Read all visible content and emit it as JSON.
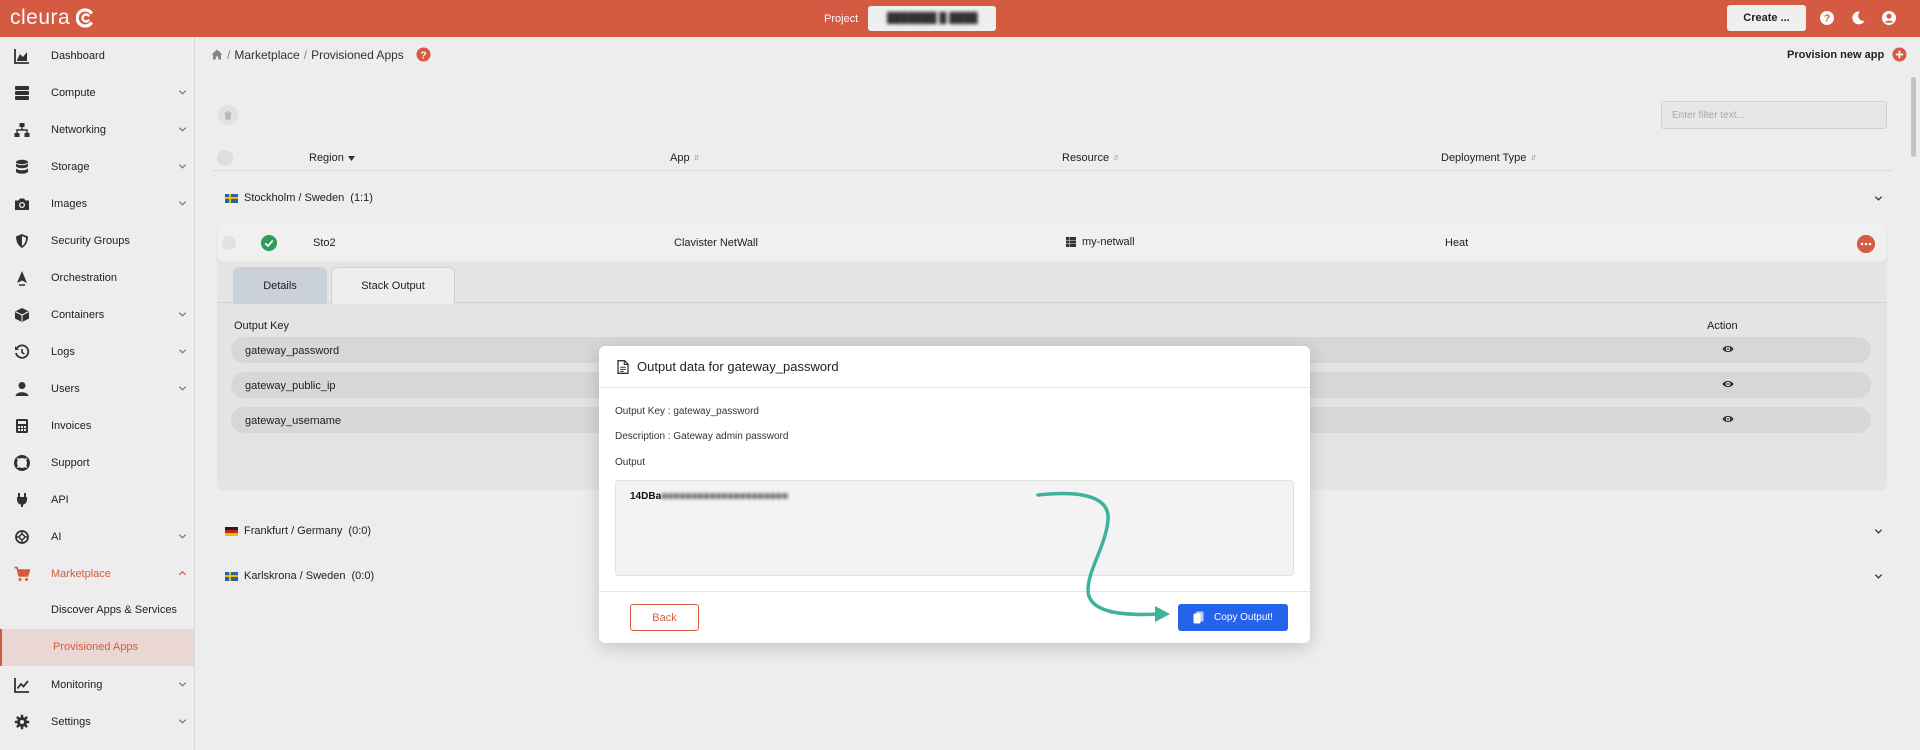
{
  "header": {
    "logo_text": "cleura",
    "project_label": "Project",
    "project_value": "███████ █ ████",
    "create_label": "Create ...",
    "colors": {
      "bar": "#d95c43"
    }
  },
  "sidebar": {
    "items": [
      {
        "label": "Dashboard",
        "icon": "chart-area-icon"
      },
      {
        "label": "Compute",
        "icon": "server-icon"
      },
      {
        "label": "Networking",
        "icon": "network-icon"
      },
      {
        "label": "Storage",
        "icon": "database-icon"
      },
      {
        "label": "Images",
        "icon": "camera-icon"
      },
      {
        "label": "Security Groups",
        "icon": "shield-icon"
      },
      {
        "label": "Orchestration",
        "icon": "orchestration-icon"
      },
      {
        "label": "Containers",
        "icon": "cube-icon"
      },
      {
        "label": "Logs",
        "icon": "history-icon"
      },
      {
        "label": "Users",
        "icon": "user-icon"
      },
      {
        "label": "Invoices",
        "icon": "calculator-icon"
      },
      {
        "label": "Support",
        "icon": "lifebuoy-icon"
      },
      {
        "label": "API",
        "icon": "plug-icon"
      },
      {
        "label": "AI",
        "icon": "ai-icon"
      },
      {
        "label": "Marketplace",
        "icon": "cart-icon"
      },
      {
        "label": "Monitoring",
        "icon": "line-chart-icon"
      },
      {
        "label": "Settings",
        "icon": "gear-icon"
      }
    ],
    "marketplace_sub": [
      {
        "label": "Discover Apps & Services"
      },
      {
        "label": "Provisioned Apps"
      }
    ]
  },
  "main": {
    "breadcrumb": [
      "Marketplace",
      "Provisioned Apps"
    ],
    "provision_label": "Provision new app",
    "filter_placeholder": "Enter filter text...",
    "columns": [
      "Region",
      "App",
      "Resource",
      "Deployment Type"
    ],
    "groups": [
      {
        "label": "Stockholm / Sweden",
        "count": "(1:1)"
      },
      {
        "label": "Frankfurt / Germany",
        "count": "(0:0)"
      },
      {
        "label": "Karlskrona / Sweden",
        "count": "(0:0)"
      }
    ],
    "row": {
      "region": "Sto2",
      "app": "Clavister NetWall",
      "resource": "my-netwall",
      "deployment": "Heat"
    },
    "tabs": [
      "Details",
      "Stack Output"
    ],
    "output_headers": {
      "key": "Output Key",
      "action": "Action"
    },
    "output_keys": [
      "gateway_password",
      "gateway_public_ip",
      "gateway_username"
    ]
  },
  "modal": {
    "title": "Output data for gateway_password",
    "output_key_line": "Output Key : gateway_password",
    "description_line": "Description : Gateway admin password",
    "output_label": "Output",
    "output_visible": "14DBa",
    "output_hidden": "■■■■■■■■■■■■■■■■■■■■■",
    "back_label": "Back",
    "copy_label": "Copy Output!",
    "annotation_color": "#3cb39a"
  }
}
